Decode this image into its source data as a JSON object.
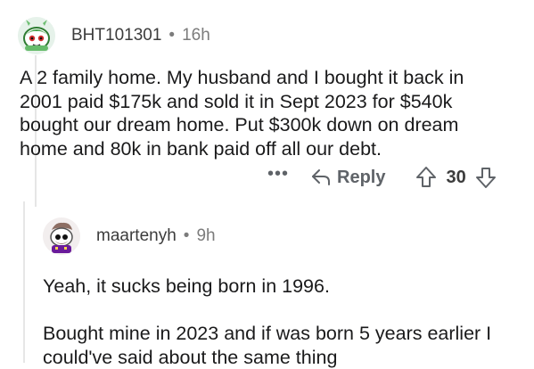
{
  "comment": {
    "username": "BHT101301",
    "separator": "•",
    "time": "16h",
    "body": "A 2 family home. My husband and I bought it back in\n2001 paid $175k and sold it in Sept 2023 for $540k\nbought our dream home. Put $300k down on dream\nhome and 80k in bank paid off all our debt.",
    "more_label": "•••",
    "reply_label": "Reply",
    "score": "30"
  },
  "reply": {
    "username": "maartenyh",
    "separator": "•",
    "time": "9h",
    "body": "Yeah, it sucks being born in 1996.\n\nBought mine in 2023 and if was born 5 years earlier I\ncould've said about the same thing"
  },
  "colors": {
    "meta_text": "#7c7c7c",
    "body_text": "#1a1a1b",
    "thread_line": "#e6e6e6"
  },
  "icons": [
    "snoo-avatar-icon",
    "reply-arrow-icon",
    "upvote-icon",
    "downvote-icon"
  ]
}
